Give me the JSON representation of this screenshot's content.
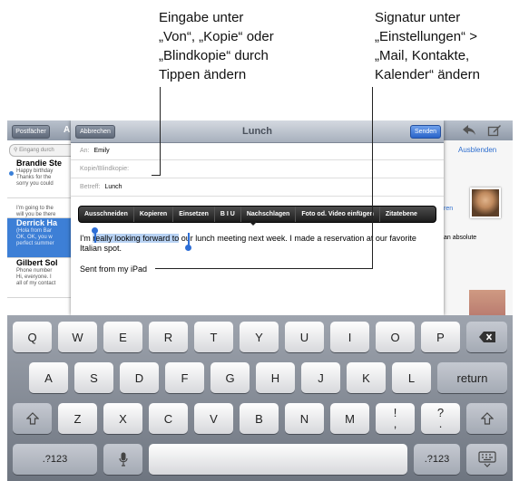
{
  "callouts": {
    "left": [
      "Eingabe unter",
      "„Von“, „Kopie“ oder",
      "„Blindkopie“ durch",
      "Tippen ändern"
    ],
    "right": [
      "Signatur unter",
      "„Einstellungen“ >",
      "„Mail, Kontakte,",
      "Kalender“ ändern"
    ]
  },
  "mail_toolbar": {
    "mailboxes_label": "Postfächer",
    "mailboxes_partial": "A",
    "hide_label": "Ausblenden"
  },
  "left_list": {
    "search_placeholder": "Eingang durch",
    "messages": [
      {
        "sender": "Brandie Ste",
        "line1": "Happy birthday",
        "line2": "Thanks for the",
        "line3": "sorry you could"
      },
      {
        "sender": "",
        "line1": "I'm going to the",
        "line2": "will you be there",
        "line3": ""
      },
      {
        "sender": "Derrick Ha",
        "line1": "(Hola from Bar",
        "line2": "OK, OK, you w",
        "line3": "perfect summer"
      },
      {
        "sender": "Gilbert Sol",
        "line1": "Phone number",
        "line2": "Hi, everyone. I",
        "line3": "all of my contact"
      }
    ]
  },
  "right_pane": {
    "snippet1": "ren",
    "snippet2": "an absolute"
  },
  "compose": {
    "cancel_label": "Abbrechen",
    "title": "Lunch",
    "send_label": "Senden",
    "to_label": "An:",
    "to_value": "Emily",
    "cc_bcc_label": "Kopie/Blindkopie:",
    "subject_label": "Betreff:",
    "subject_value": "Lunch",
    "edit_menu": [
      "Ausschneiden",
      "Kopieren",
      "Einsetzen",
      "B I U",
      "Nachschlagen",
      "Foto od. Video einfügen",
      "Zitatebene"
    ],
    "body_before": "I'm ",
    "body_selected": "really looking forward to",
    "body_after": " our lunch meeting next week. I made a reservation at our favorite Italian spot.",
    "signature": "Sent from my iPad"
  },
  "keyboard": {
    "row1": [
      "Q",
      "W",
      "E",
      "R",
      "T",
      "Y",
      "U",
      "I",
      "O",
      "P"
    ],
    "row2": [
      "A",
      "S",
      "D",
      "F",
      "G",
      "H",
      "J",
      "K",
      "L"
    ],
    "row3": [
      "Z",
      "X",
      "C",
      "V",
      "B",
      "N",
      "M"
    ],
    "return_label": "return",
    "exclaim": "!",
    "exclaim_sub": ",",
    "question": "?",
    "question_sub": ".",
    "numbers_label": ".?123",
    "backspace_icon": "backspace-icon",
    "shift_icon": "shift-icon",
    "mic_icon": "microphone-icon",
    "hide_kb_icon": "keyboard-hide-icon"
  }
}
